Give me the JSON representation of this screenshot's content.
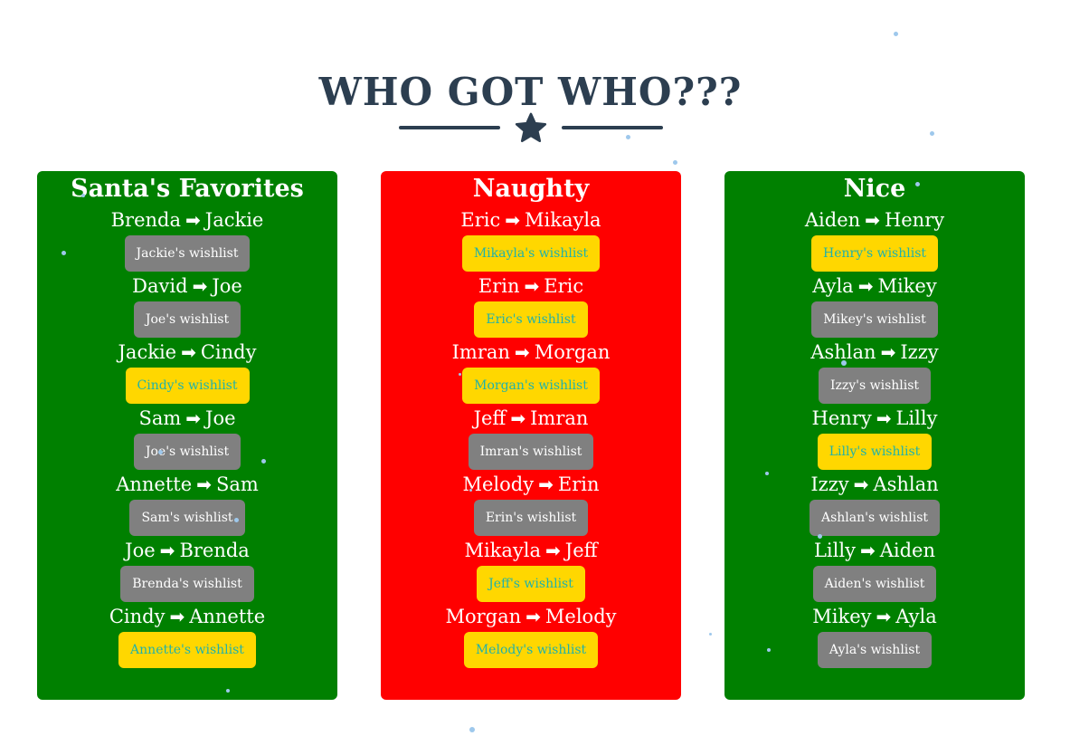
{
  "title": "WHO GOT WHO???",
  "divider": {
    "icon": "star-icon"
  },
  "colors": {
    "heading": "#2c3e50",
    "green_panel": "#008000",
    "red_panel": "#ff0000",
    "gray_button": "#808080",
    "yellow_button": "#ffd700",
    "yellow_button_text": "#20b2aa",
    "snow": "#9ec8ec"
  },
  "arrow": "➡",
  "panels": [
    {
      "title": "Santa's Favorites",
      "color": "green",
      "pairs": [
        {
          "giver": "Brenda",
          "receiver": "Jackie",
          "button": "Jackie's wishlist",
          "style": "gray"
        },
        {
          "giver": "David",
          "receiver": "Joe",
          "button": "Joe's wishlist",
          "style": "gray"
        },
        {
          "giver": "Jackie",
          "receiver": "Cindy",
          "button": "Cindy's wishlist",
          "style": "yellow"
        },
        {
          "giver": "Sam",
          "receiver": "Joe",
          "button": "Joe's wishlist",
          "style": "gray"
        },
        {
          "giver": "Annette",
          "receiver": "Sam",
          "button": "Sam's wishlist",
          "style": "gray"
        },
        {
          "giver": "Joe",
          "receiver": "Brenda",
          "button": "Brenda's wishlist",
          "style": "gray"
        },
        {
          "giver": "Cindy",
          "receiver": "Annette",
          "button": "Annette's wishlist",
          "style": "yellow"
        }
      ]
    },
    {
      "title": "Naughty",
      "color": "red",
      "pairs": [
        {
          "giver": "Eric",
          "receiver": "Mikayla",
          "button": "Mikayla's wishlist",
          "style": "yellow"
        },
        {
          "giver": "Erin",
          "receiver": "Eric",
          "button": "Eric's wishlist",
          "style": "yellow"
        },
        {
          "giver": "Imran",
          "receiver": "Morgan",
          "button": "Morgan's wishlist",
          "style": "yellow"
        },
        {
          "giver": "Jeff",
          "receiver": "Imran",
          "button": "Imran's wishlist",
          "style": "gray"
        },
        {
          "giver": "Melody",
          "receiver": "Erin",
          "button": "Erin's wishlist",
          "style": "gray"
        },
        {
          "giver": "Mikayla",
          "receiver": "Jeff",
          "button": "Jeff's wishlist",
          "style": "yellow"
        },
        {
          "giver": "Morgan",
          "receiver": "Melody",
          "button": "Melody's wishlist",
          "style": "yellow"
        }
      ]
    },
    {
      "title": "Nice",
      "color": "green",
      "pairs": [
        {
          "giver": "Aiden",
          "receiver": "Henry",
          "button": "Henry's wishlist",
          "style": "yellow"
        },
        {
          "giver": "Ayla",
          "receiver": "Mikey",
          "button": "Mikey's wishlist",
          "style": "gray"
        },
        {
          "giver": "Ashlan",
          "receiver": "Izzy",
          "button": "Izzy's wishlist",
          "style": "gray"
        },
        {
          "giver": "Henry",
          "receiver": "Lilly",
          "button": "Lilly's wishlist",
          "style": "yellow"
        },
        {
          "giver": "Izzy",
          "receiver": "Ashlan",
          "button": "Ashlan's wishlist",
          "style": "gray"
        },
        {
          "giver": "Lilly",
          "receiver": "Aiden",
          "button": "Aiden's wishlist",
          "style": "gray"
        },
        {
          "giver": "Mikey",
          "receiver": "Ayla",
          "button": "Ayla's wishlist",
          "style": "gray"
        }
      ]
    }
  ]
}
